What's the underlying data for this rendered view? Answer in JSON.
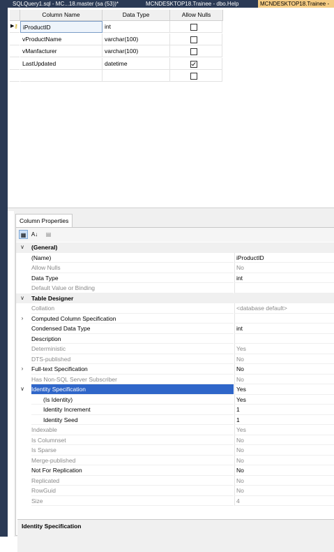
{
  "tabs": [
    {
      "label": "SQLQuery1.sql - MC...18.master (sa (53))*",
      "active": false
    },
    {
      "label": "MCNDESKTOP18.Trainee - dbo.Help",
      "active": false
    },
    {
      "label": "MCNDESKTOP18.Trainee -",
      "active": true
    }
  ],
  "table": {
    "headers": [
      "Column Name",
      "Data Type",
      "Allow Nulls"
    ],
    "rows": [
      {
        "name": "iProductID",
        "type": "int",
        "allow_nulls": false,
        "key": true,
        "selected": true
      },
      {
        "name": "vProductName",
        "type": "varchar(100)",
        "allow_nulls": false
      },
      {
        "name": "vManfacturer",
        "type": "varchar(100)",
        "allow_nulls": false
      },
      {
        "name": "LastUpdated",
        "type": "datetime",
        "allow_nulls": true
      },
      {
        "name": "",
        "type": "",
        "allow_nulls": false
      }
    ]
  },
  "properties": {
    "tab_label": "Column Properties",
    "toolbar": {
      "categorized_icon": "categorized-icon",
      "alphabetical_icon": "alphabetical-sort-icon",
      "pages_icon": "property-pages-icon"
    },
    "rows": [
      {
        "kind": "cat",
        "expander": "v",
        "name": "(General)",
        "value": ""
      },
      {
        "name": "(Name)",
        "value": "iProductID"
      },
      {
        "name": "Allow Nulls",
        "value": "No",
        "dim": true
      },
      {
        "name": "Data Type",
        "value": "int"
      },
      {
        "name": "Default Value or Binding",
        "value": "",
        "dim": true
      },
      {
        "kind": "cat",
        "expander": "v",
        "name": "Table Designer",
        "value": ""
      },
      {
        "name": "Collation",
        "value": "<database default>",
        "dim": true
      },
      {
        "name": "Computed Column Specification",
        "value": "",
        "expander": ">"
      },
      {
        "name": "Condensed Data Type",
        "value": "int"
      },
      {
        "name": "Description",
        "value": ""
      },
      {
        "name": "Deterministic",
        "value": "Yes",
        "dim": true
      },
      {
        "name": "DTS-published",
        "value": "No",
        "dim": true
      },
      {
        "name": "Full-text Specification",
        "value": "No",
        "expander": ">"
      },
      {
        "name": "Has Non-SQL Server Subscriber",
        "value": "No",
        "dim": true
      },
      {
        "name": "Identity Specification",
        "value": "Yes",
        "expander": "v",
        "highlight": true
      },
      {
        "name": "(Is Identity)",
        "value": "Yes",
        "indent": true
      },
      {
        "name": "Identity Increment",
        "value": "1",
        "indent": true
      },
      {
        "name": "Identity Seed",
        "value": "1",
        "indent": true
      },
      {
        "name": "Indexable",
        "value": "Yes",
        "dim": true
      },
      {
        "name": "Is Columnset",
        "value": "No",
        "dim": true
      },
      {
        "name": "Is Sparse",
        "value": "No",
        "dim": true
      },
      {
        "name": "Merge-published",
        "value": "No",
        "dim": true
      },
      {
        "name": "Not For Replication",
        "value": "No"
      },
      {
        "name": "Replicated",
        "value": "No",
        "dim": true
      },
      {
        "name": "RowGuid",
        "value": "No",
        "dim": true
      },
      {
        "name": "Size",
        "value": "4",
        "dim": true
      }
    ],
    "description_title": "Identity Specification"
  },
  "colors": {
    "accent": "#2f66c9",
    "tab_active": "#f5cc84",
    "chrome": "#2b3a55"
  }
}
